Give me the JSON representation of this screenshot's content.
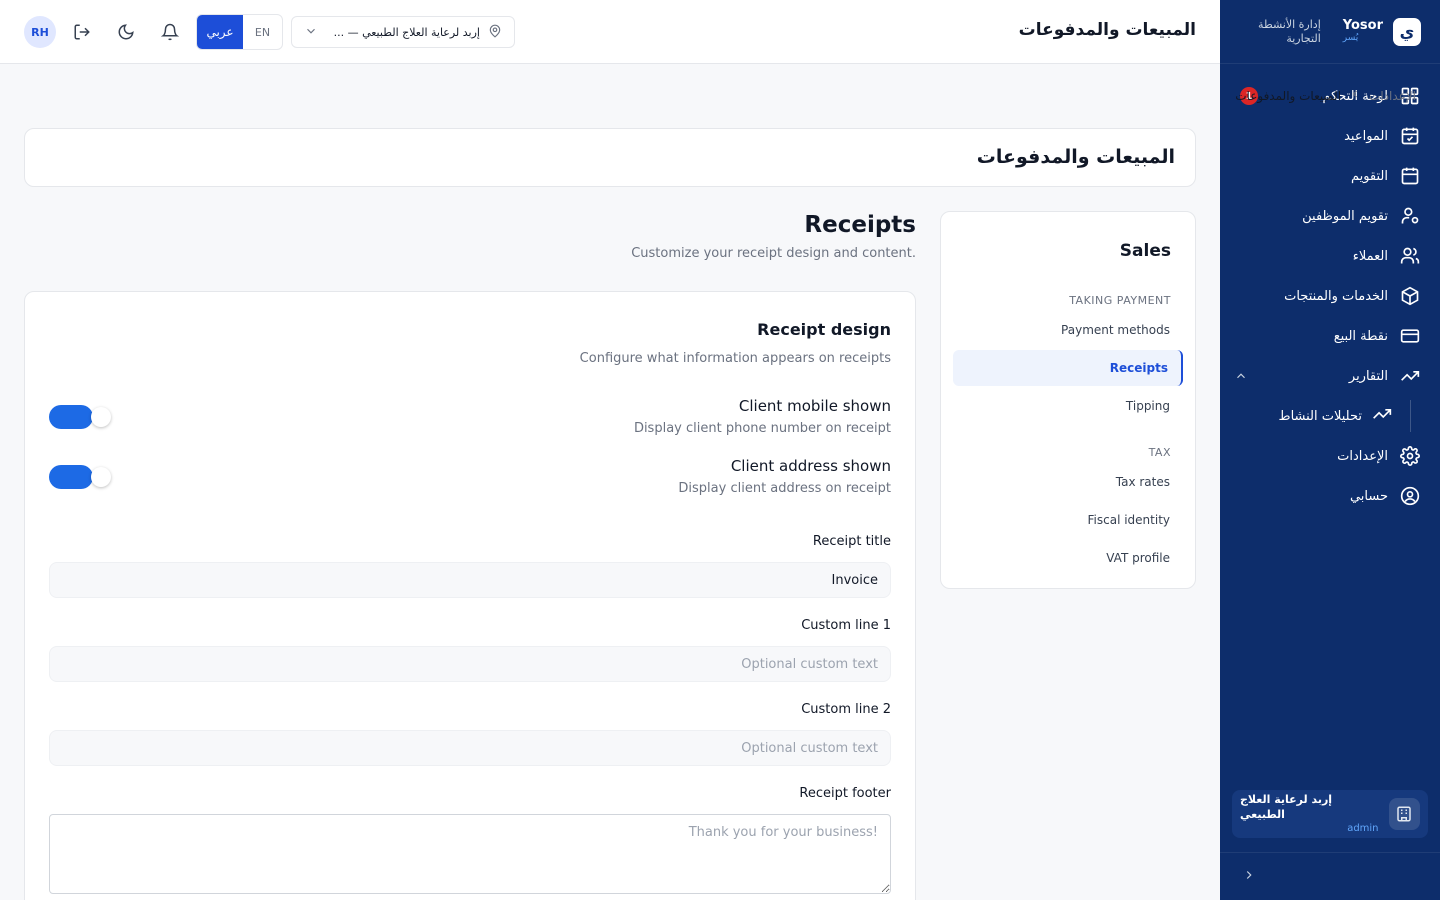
{
  "brand": {
    "name": "Yosor",
    "name_ar": "يُسر",
    "logo_letter": "ي",
    "tagline": "إدارة الأنشطة التجارية"
  },
  "sidebar": {
    "items": [
      {
        "label": "لوحة التحكم",
        "icon": "dashboard-icon",
        "badge": "1"
      },
      {
        "label": "المواعيد",
        "icon": "calendar-check-icon"
      },
      {
        "label": "التقويم",
        "icon": "calendar-icon"
      },
      {
        "label": "تقويم الموظفين",
        "icon": "user-gear-icon"
      },
      {
        "label": "العملاء",
        "icon": "users-icon"
      },
      {
        "label": "الخدمات والمنتجات",
        "icon": "box-icon"
      },
      {
        "label": "نقطة البيع",
        "icon": "credit-card-icon"
      },
      {
        "label": "التقارير",
        "icon": "trending-up-icon",
        "expanded": true
      },
      {
        "label": "تحليلات النشاط",
        "icon": "trending-up-icon",
        "sub": true
      },
      {
        "label": "الإعدادات",
        "icon": "gear-icon"
      },
      {
        "label": "حسابي",
        "icon": "user-circle-icon"
      }
    ],
    "org": {
      "name": "إربد لرعاية العلاج الطبيعي",
      "role": "admin"
    }
  },
  "topbar": {
    "title": "المبيعات والمدفوعات",
    "avatar": "RH",
    "lang_ar": "عربي",
    "lang_en": "EN",
    "location": "إربد لرعاية العلاج الطبيعي — ..."
  },
  "breadcrumb": {
    "parent": "الإعدادات",
    "current": "المبيعات والمدفوعات"
  },
  "page": {
    "title": "المبيعات والمدفوعات"
  },
  "sales_nav": {
    "title": "Sales",
    "section1": "TAKING PAYMENT",
    "section2": "TAX",
    "items": [
      "Payment methods",
      "Receipts",
      "Tipping",
      "Tax rates",
      "Fiscal identity",
      "VAT profile"
    ],
    "active": "Receipts"
  },
  "receipts": {
    "title": "Receipts",
    "subtitle": "Customize your receipt design and content.",
    "design_title": "Receipt design",
    "design_subtitle": "Configure what information appears on receipts",
    "toggles": [
      {
        "label": "Client mobile shown",
        "desc": "Display client phone number on receipt",
        "on": true
      },
      {
        "label": "Client address shown",
        "desc": "Display client address on receipt",
        "on": true
      }
    ],
    "fields": {
      "title_label": "Receipt title",
      "title_value": "Invoice",
      "line1_label": "Custom line 1",
      "line1_placeholder": "Optional custom text",
      "line2_label": "Custom line 2",
      "line2_placeholder": "Optional custom text",
      "footer_label": "Receipt footer",
      "footer_placeholder": "Thank you for your business!"
    }
  },
  "colors": {
    "sidebar": "#0d2d6b",
    "accent": "#1d4ed8",
    "toggle": "#1d6ae5",
    "badge": "#dc2626"
  }
}
